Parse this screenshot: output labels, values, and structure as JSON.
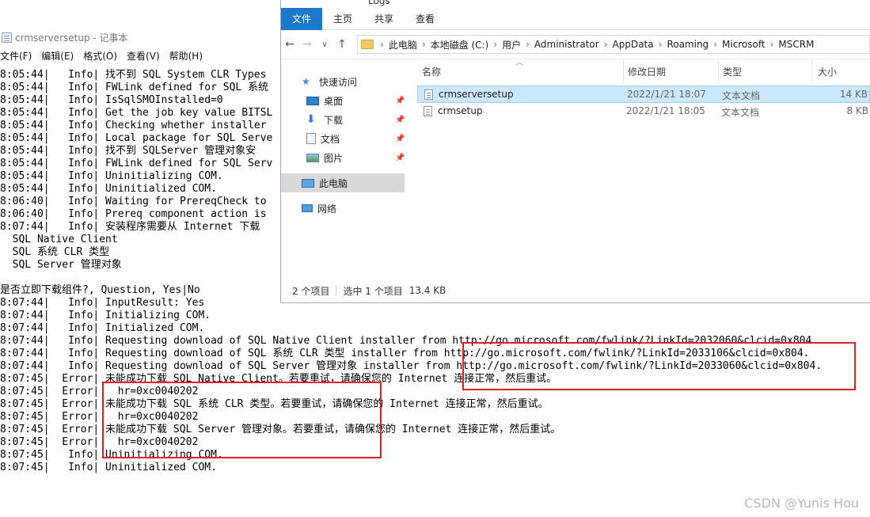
{
  "notepad": {
    "title": "crmserversetup - 记事本",
    "menu": [
      "文件(F)",
      "编辑(E)",
      "格式(O)",
      "查看(V)",
      "帮助(H)"
    ],
    "lines": [
      "8:05:44|   Info| 找不到 SQL System CLR Types",
      "8:05:44|   Info| FWLink defined for SQL 系统",
      "8:05:44|   Info| IsSqlSMOInstalled=0",
      "8:05:44|   Info| Get the job key value BITSL",
      "8:05:44|   Info| Checking whether installer",
      "8:05:44|   Info| Local package for SQL Serve",
      "8:05:44|   Info| 找不到 SQLServer 管理对象安",
      "8:05:44|   Info| FWLink defined for SQL Serv",
      "8:05:44|   Info| Uninitializing COM.",
      "8:05:44|   Info| Uninitialized COM.",
      "8:06:40|   Info| Waiting for PrereqCheck to",
      "8:06:40|   Info| Prereq component action is",
      "8:07:44|   Info| 安装程序需要从 Internet 下载",
      "  SQL Native Client",
      "  SQL 系统 CLR 类型",
      "  SQL Server 管理对象",
      "",
      "是否立即下载组件?, Question, Yes|No",
      "8:07:44|   Info| InputResult: Yes",
      "8:07:44|   Info| Initializing COM.",
      "8:07:44|   Info| Initialized COM.",
      "8:07:44|   Info| Requesting download of SQL Native Client installer from http://go.microsoft.com/fwlink/?LinkId=2032060&clcid=0x804.",
      "8:07:44|   Info| Requesting download of SQL 系统 CLR 类型 installer from http://go.microsoft.com/fwlink/?LinkId=2033106&clcid=0x804.",
      "8:07:44|   Info| Requesting download of SQL Server 管理对象 installer from http://go.microsoft.com/fwlink/?LinkId=2033060&clcid=0x804.",
      "8:07:45|  Error| 未能成功下载 SQL Native Client。若要重试，请确保您的 Internet 连接正常，然后重试。",
      "8:07:45|  Error|   hr=0xc0040202",
      "8:07:45|  Error| 未能成功下载 SQL 系统 CLR 类型。若要重试，请确保您的 Internet 连接正常，然后重试。",
      "8:07:45|  Error|   hr=0xc0040202",
      "8:07:45|  Error| 未能成功下载 SQL Server 管理对象。若要重试，请确保您的 Internet 连接正常，然后重试。",
      "8:07:45|  Error|   hr=0xc0040202",
      "8:07:45|   Info| Uninitializing COM.",
      "8:07:45|   Info| Uninitialized COM."
    ]
  },
  "explorer": {
    "title": "Logs",
    "ribbon_tabs": [
      "文件",
      "主页",
      "共享",
      "查看"
    ],
    "breadcrumb": [
      "此电脑",
      "本地磁盘 (C:)",
      "用户",
      "Administrator",
      "AppData",
      "Roaming",
      "Microsoft",
      "MSCRM"
    ],
    "nav": [
      {
        "label": "快速访问",
        "icon": "star-icon",
        "pinned": false
      },
      {
        "label": "桌面",
        "icon": "desktop-icon",
        "pinned": true
      },
      {
        "label": "下载",
        "icon": "download-icon",
        "pinned": true
      },
      {
        "label": "文档",
        "icon": "document-icon",
        "pinned": true
      },
      {
        "label": "图片",
        "icon": "picture-icon",
        "pinned": true
      },
      {
        "label": "此电脑",
        "icon": "computer-icon",
        "pinned": false
      },
      {
        "label": "网络",
        "icon": "network-icon",
        "pinned": false
      }
    ],
    "columns": {
      "name": "名称",
      "date": "修改日期",
      "type": "类型",
      "size": "大小"
    },
    "files": [
      {
        "name": "crmserversetup",
        "date": "2022/1/21 18:07",
        "type": "文本文档",
        "size": "14 KB",
        "selected": true
      },
      {
        "name": "crmsetup",
        "date": "2022/1/21 18:05",
        "type": "文本文档",
        "size": "8 KB",
        "selected": false
      }
    ],
    "status": {
      "count": "2 个项目",
      "selected": "选中 1 个项目",
      "size": "13.4 KB"
    }
  },
  "watermark": "CSDN @Yunis Hou",
  "colors": {
    "highlight_box": "#e02020",
    "ribbon_file": "#1979ca",
    "selection": "#cce8ff"
  }
}
